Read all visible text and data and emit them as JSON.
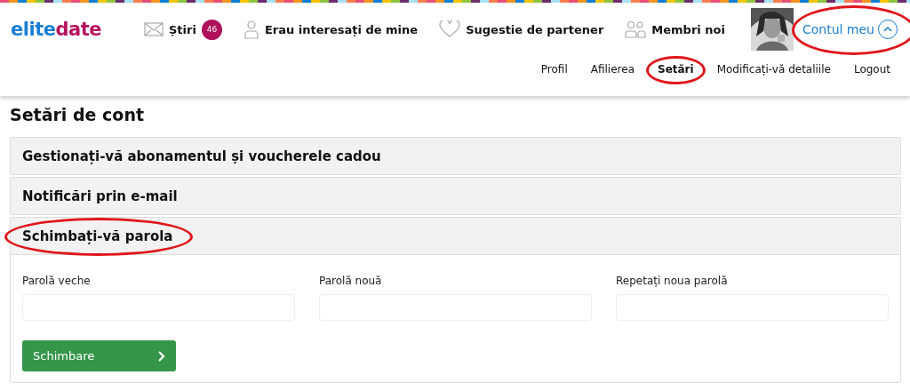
{
  "logo": {
    "part_1": "elite",
    "part_2": "date"
  },
  "nav": [
    {
      "kind": "mail",
      "label": "Știri",
      "badge": "46"
    },
    {
      "kind": "person",
      "label": "Erau interesați de mine"
    },
    {
      "kind": "heart",
      "label": "Sugestie de partener"
    },
    {
      "kind": "people",
      "label": "Membri noi"
    }
  ],
  "account": {
    "label": "Contul meu",
    "expanded": true,
    "circled": true
  },
  "submenu": [
    {
      "label": "Profil",
      "selected": false,
      "circled": false
    },
    {
      "label": "Afilierea",
      "selected": false,
      "circled": false
    },
    {
      "label": "Setări",
      "selected": true,
      "circled": true
    },
    {
      "label": "Modificați-vă detaliile",
      "selected": false,
      "circled": false
    },
    {
      "label": "Logout",
      "selected": false,
      "circled": false
    }
  ],
  "page_title": "Setări de cont",
  "sections": [
    {
      "title": "Gestionați-vă abonamentul și voucherele cadou",
      "expanded": false,
      "circled": false
    },
    {
      "title": "Notificări prin e-mail",
      "expanded": false,
      "circled": false
    },
    {
      "title": "Schimbați-vă parola",
      "expanded": true,
      "circled": true,
      "fields": [
        {
          "label": "Parolă veche"
        },
        {
          "label": "Parolă nouă"
        },
        {
          "label": "Repetați noua parolă"
        }
      ],
      "button": "Schimbare"
    }
  ]
}
